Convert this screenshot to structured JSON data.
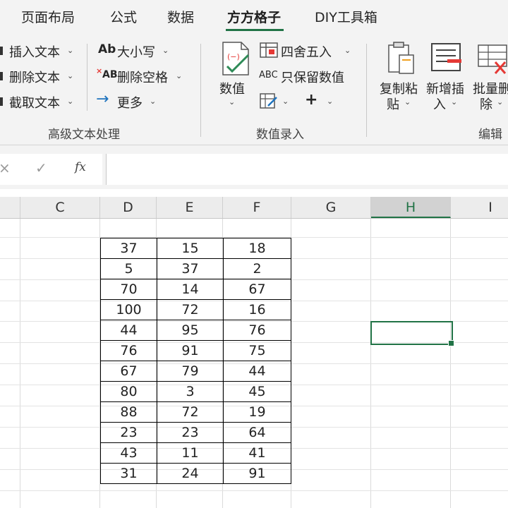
{
  "tabs": [
    {
      "label": "页面布局"
    },
    {
      "label": "公式"
    },
    {
      "label": "数据"
    },
    {
      "label": "方方格子"
    },
    {
      "label": "DIY工具箱"
    }
  ],
  "ribbon": {
    "text_group": {
      "insert_text": "插入文本",
      "delete_text": "删除文本",
      "extract_text": "截取文本",
      "case_icon_text": "Ab",
      "case_label": "大小写",
      "delete_space_icon_text": "AB",
      "delete_space_label": "删除空格",
      "more_label": "更多",
      "group_label": "高级文本处理"
    },
    "number_group": {
      "value_label": "数值",
      "round_label": "四舍五入",
      "keep_num_icon_text": "ABC",
      "keep_num_label": "只保留数值",
      "plus_label": "+",
      "group_label": "数值录入"
    },
    "edit_group": {
      "copy_paste_label_1": "复制粘",
      "copy_paste_label_2": "贴",
      "new_insert_label_1": "新增插",
      "new_insert_label_2": "入",
      "batch_delete_label_1": "批量删",
      "batch_delete_label_2": "除",
      "group_label": "编辑"
    }
  },
  "formula_bar": {
    "cancel_icon": "×",
    "confirm_icon": "✓",
    "fx_label": "fx",
    "value": ""
  },
  "columns": [
    "C",
    "D",
    "E",
    "F",
    "G",
    "H",
    "I"
  ],
  "selected_column": "H",
  "table": {
    "rows": [
      [
        "37",
        "15",
        "18"
      ],
      [
        "5",
        "37",
        "2"
      ],
      [
        "70",
        "14",
        "67"
      ],
      [
        "100",
        "72",
        "16"
      ],
      [
        "44",
        "95",
        "76"
      ],
      [
        "76",
        "91",
        "75"
      ],
      [
        "67",
        "79",
        "44"
      ],
      [
        "80",
        "3",
        "45"
      ],
      [
        "88",
        "72",
        "19"
      ],
      [
        "23",
        "23",
        "64"
      ],
      [
        "43",
        "11",
        "41"
      ],
      [
        "31",
        "24",
        "91"
      ]
    ]
  },
  "colors": {
    "accent_green": "#217346",
    "ribbon_bg": "#f3f3f3",
    "red_icon": "#e53935"
  }
}
